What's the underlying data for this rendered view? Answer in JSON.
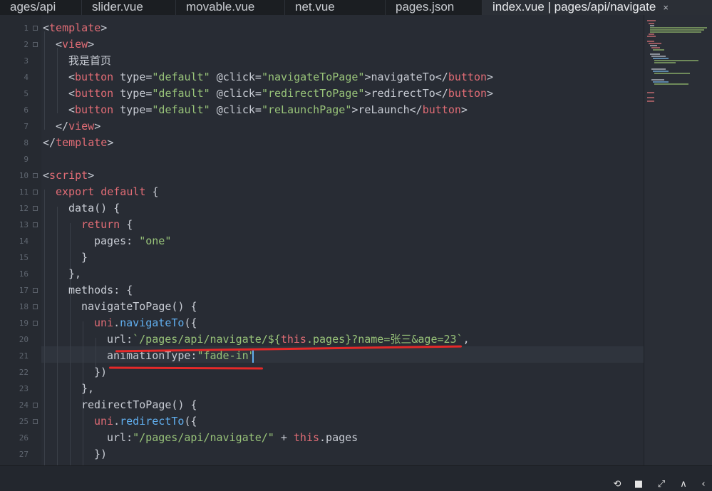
{
  "tabs": [
    {
      "label": "ages/api"
    },
    {
      "label": "slider.vue"
    },
    {
      "label": "movable.vue"
    },
    {
      "label": "net.vue"
    },
    {
      "label": "pages.json"
    },
    {
      "label": "index.vue | pages/api/navigate",
      "active": true,
      "close": "×"
    }
  ],
  "editor": {
    "lines": [
      {
        "n": "1"
      },
      {
        "n": "2"
      },
      {
        "n": "3"
      },
      {
        "n": "4"
      },
      {
        "n": "5"
      },
      {
        "n": "6"
      },
      {
        "n": "7"
      },
      {
        "n": "8"
      },
      {
        "n": "9"
      },
      {
        "n": "10"
      },
      {
        "n": "11"
      },
      {
        "n": "12"
      },
      {
        "n": "13"
      },
      {
        "n": "14"
      },
      {
        "n": "15"
      },
      {
        "n": "16"
      },
      {
        "n": "17"
      },
      {
        "n": "18"
      },
      {
        "n": "19"
      },
      {
        "n": "20"
      },
      {
        "n": "21"
      },
      {
        "n": "22"
      },
      {
        "n": "23"
      },
      {
        "n": "24"
      },
      {
        "n": "25"
      },
      {
        "n": "26"
      },
      {
        "n": "27"
      }
    ],
    "code": {
      "l1_open": "<",
      "l1_tag": "template",
      "l1_close": ">",
      "l2_open": "<",
      "l2_tag": "view",
      "l2_close": ">",
      "l3_text": "我是首页",
      "btn_tag": "button",
      "type_attr": " type=",
      "type_val": "\"default\"",
      "click_attr": " @click=",
      "l4_handler": "\"navigateToPage\"",
      "l4_label": "navigateTo",
      "l5_handler": "\"redirectToPage\"",
      "l5_label": "redirectTo",
      "l6_handler": "\"reLaunchPage\"",
      "l6_label": "reLaunch",
      "l10_tag": "script",
      "l11_export": "export default",
      "l11_brace": " {",
      "l12_text": "data() {",
      "l13_return": "return",
      "l13_brace": " {",
      "l14_key": "pages: ",
      "l14_val": "\"one\"",
      "l15_text": "}",
      "l16_text": "},",
      "l17_text": "methods: {",
      "l18_text": "navigateToPage() {",
      "uni": "uni",
      "l19_method": "navigateTo",
      "l19_paren": "({",
      "l20_key": "url:",
      "l20_str1": "`/pages/api/navigate/${",
      "l20_this": "this",
      "l20_str2": ".pages}?name=张三&age=23`",
      "l20_comma": ",",
      "l21_key": "animationType:",
      "l21_val": "\"fade-in\"",
      "l22_text": "})",
      "l23_text": "},",
      "l24_text": "redirectToPage() {",
      "l25_method": "redirectTo",
      "l25_paren": "({",
      "l26_key": "url:",
      "l26_str": "\"/pages/api/navigate/\"",
      "l26_plus": " + ",
      "l26_this": "this",
      "l26_rest": ".pages",
      "l27_text": "})"
    }
  },
  "status_icons": [
    {
      "icon": "refresh-icon",
      "glyph": "⟲"
    },
    {
      "icon": "stop-icon",
      "glyph": "■"
    },
    {
      "icon": "expand-icon",
      "glyph": "⤢"
    },
    {
      "icon": "chevron-up-icon",
      "glyph": "∧"
    },
    {
      "icon": "chevron-left-icon",
      "glyph": "‹"
    }
  ],
  "colors": {
    "background": "#282c34",
    "tag": "#e06c75",
    "string": "#98c379",
    "method": "#61afef",
    "underline": "#e52929"
  }
}
